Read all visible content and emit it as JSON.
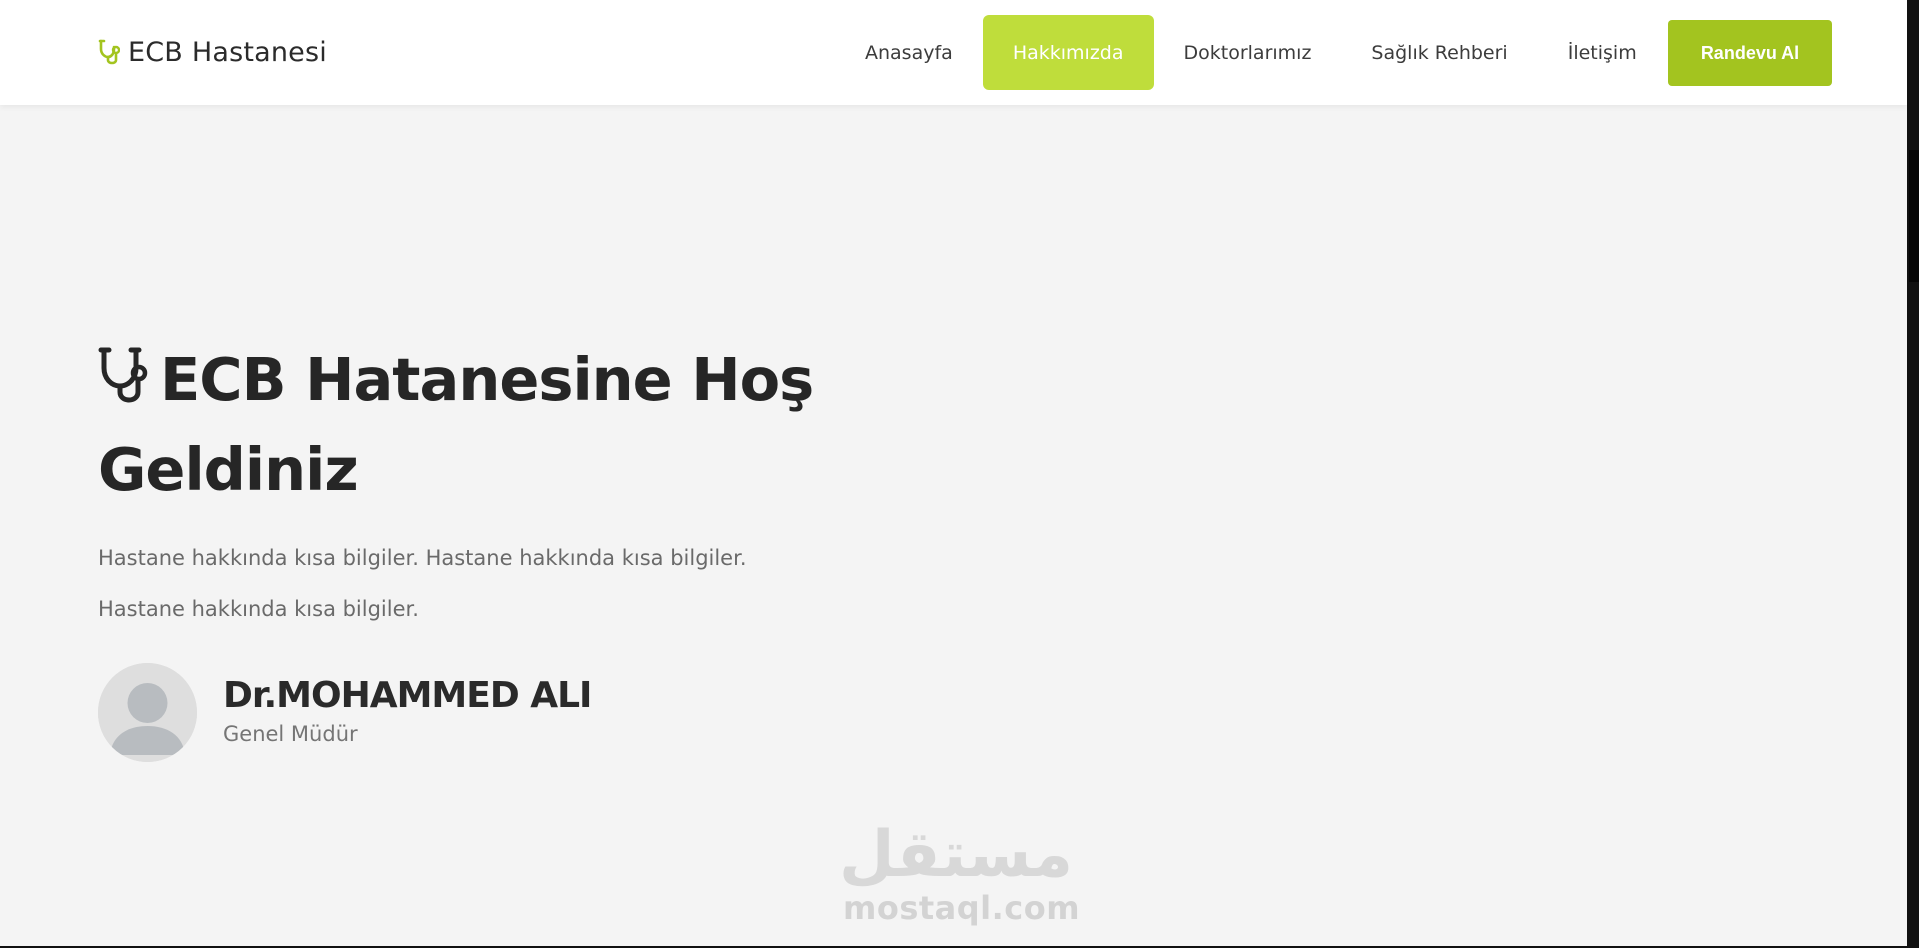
{
  "header": {
    "brand_name": "ECB Hastanesi",
    "nav": [
      {
        "label": "Anasayfa",
        "active": false
      },
      {
        "label": "Hakkımızda",
        "active": true
      },
      {
        "label": "Doktorlarımız",
        "active": false
      },
      {
        "label": "Sağlık Rehberi",
        "active": false
      },
      {
        "label": "İletişim",
        "active": false
      }
    ],
    "cta_label": "Randevu Al"
  },
  "hero": {
    "title": "ECB Hatanesine Hoş Geldiniz",
    "description_line1": "Hastane hakkında kısa bilgiler. Hastane hakkında kısa bilgiler.",
    "description_line2": "Hastane hakkında kısa bilgiler."
  },
  "director": {
    "name": "Dr.MOHAMMED ALI",
    "role": "Genel Müdür"
  },
  "watermark": {
    "logo_text": "مستقل",
    "url_text": "mostaql.com"
  },
  "colors": {
    "accent": "#bfdd3b",
    "accent_dark": "#a3c41f",
    "page_bg": "#f4f4f4",
    "header_bg": "#ffffff",
    "text_dark": "#262626",
    "text_muted": "#6a6a6a"
  },
  "icons": {
    "brand": "stethoscope-icon",
    "hero": "stethoscope-icon",
    "avatar": "user-placeholder-icon"
  }
}
